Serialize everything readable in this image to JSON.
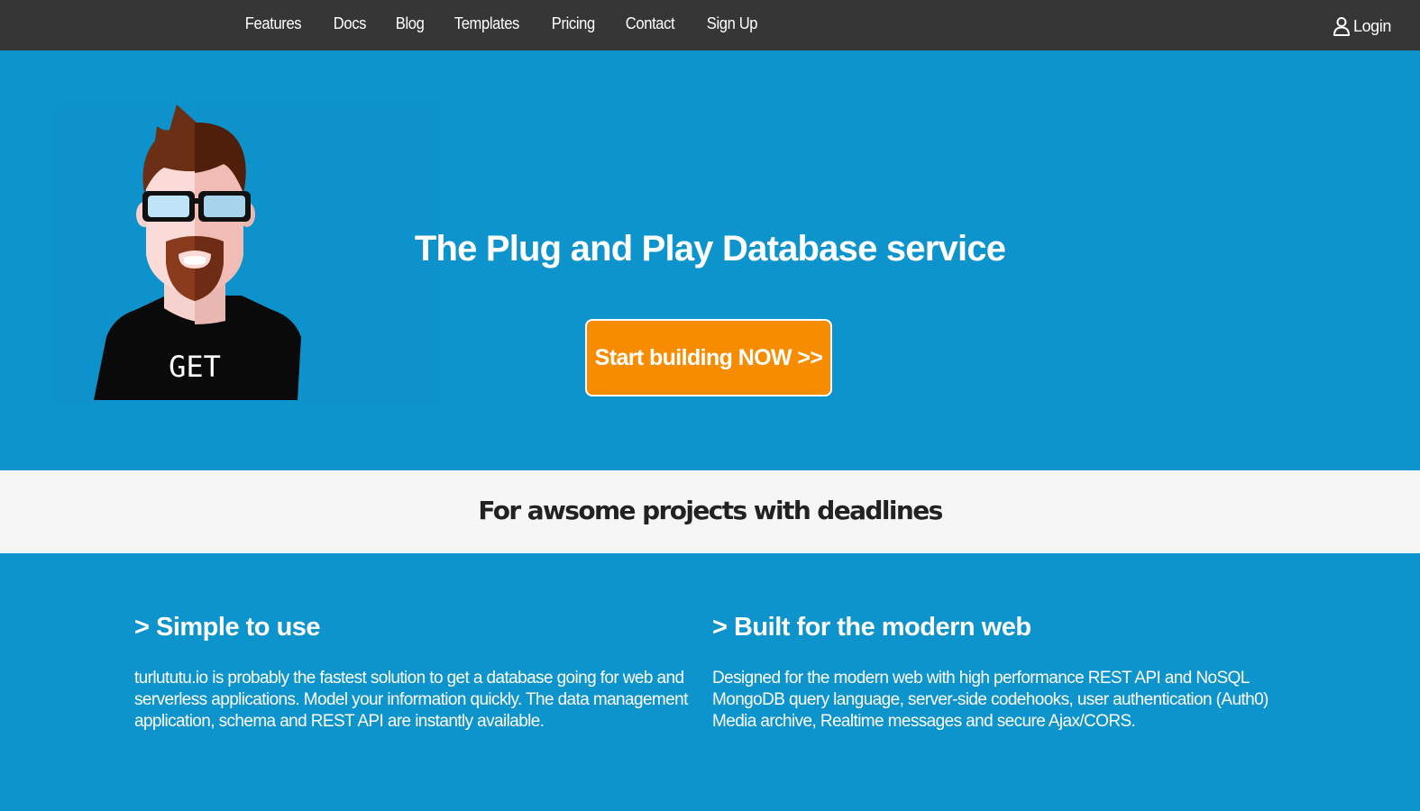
{
  "nav": {
    "links": [
      "Features",
      "Docs",
      "Blog",
      "Templates",
      "Pricing",
      "Contact",
      "Sign Up"
    ],
    "login_label": "Login"
  },
  "hero": {
    "avatar_shirt_text": "GET",
    "title": "The Plug and Play Database service",
    "cta_label": "Start building NOW >>"
  },
  "tagline": "For awsome projects with deadlines",
  "features": [
    {
      "title": "> Simple to use",
      "text": "turlututu.io is probably the fastest solution to get a database going for web and serverless applications. Model your information quickly. The data management application, schema and REST API are instantly available."
    },
    {
      "title": "> Built for the modern web",
      "text": "Designed for the modern web with high performance REST API and NoSQL MongoDB query language, server-side codehooks, user authentication (Auth0) Media archive, Realtime messages and secure Ajax/CORS."
    }
  ],
  "colors": {
    "navbar_bg": "#363636",
    "brand_blue": "#0e94cd",
    "cta_orange": "#f78c00",
    "tagline_bg": "#f6f6f6"
  },
  "icons": {
    "login": "user-icon"
  }
}
